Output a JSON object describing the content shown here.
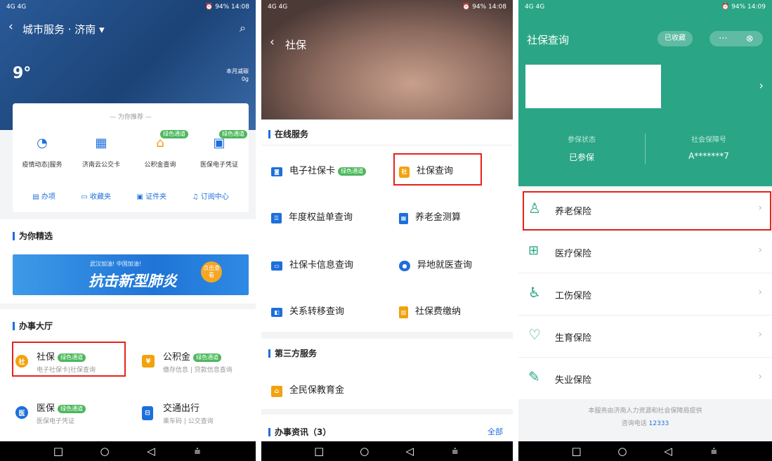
{
  "status": {
    "left": "4G 4G",
    "p1": "⏰ 94% 14:08",
    "p2": "⏰ 94% 14:08",
    "p3": "⏰ 94% 14:09"
  },
  "nav": {
    "square": "□",
    "circle": "○",
    "back": "◁",
    "menu": "⩧"
  },
  "screen1": {
    "title": "城市服务 · 济南 ▾",
    "temp": "9°",
    "air_label": "本月减碳",
    "air_value": "0g",
    "recommend_header": "为你推荐",
    "recommend": [
      {
        "label": "疫情动态|服务",
        "badge": ""
      },
      {
        "label": "济南云公交卡",
        "badge": ""
      },
      {
        "label": "公积金查询",
        "badge": "绿色通道"
      },
      {
        "label": "医保电子凭证",
        "badge": "绿色通道"
      }
    ],
    "tools": [
      "办项",
      "收藏夹",
      "证件夹",
      "订阅中心"
    ],
    "featured_title": "为你精选",
    "banner": {
      "small": "武汉加油! 中国加油!",
      "big": "抗击新型肺炎",
      "btn": "点击查看"
    },
    "hall_title": "办事大厅",
    "hall": [
      {
        "title": "社保",
        "badge": "绿色通道",
        "sub": "电子社保卡|社保查询",
        "color": "#f2a20d",
        "glyph": "社"
      },
      {
        "title": "公积金",
        "badge": "绿色通道",
        "sub": "缴存信息 | 贷款信息查询",
        "color": "#f2a20d",
        "glyph": "¥"
      },
      {
        "title": "医保",
        "badge": "绿色通道",
        "sub": "医保电子凭证",
        "color": "#1d6fdb",
        "glyph": "医"
      },
      {
        "title": "交通出行",
        "badge": "",
        "sub": "乘车码 | 公交查询",
        "color": "#1d6fdb",
        "glyph": "⊟"
      }
    ]
  },
  "screen2": {
    "title": "社保",
    "online_title": "在线服务",
    "services": [
      {
        "label": "电子社保卡",
        "badge": "绿色通道",
        "color": "#1d6fdb"
      },
      {
        "label": "社保查询",
        "badge": "",
        "color": "#f2a20d"
      },
      {
        "label": "年度权益单查询",
        "badge": "",
        "color": "#1d6fdb"
      },
      {
        "label": "养老金测算",
        "badge": "",
        "color": "#1d6fdb"
      },
      {
        "label": "社保卡信息查询",
        "badge": "",
        "color": "#1d6fdb"
      },
      {
        "label": "异地就医查询",
        "badge": "",
        "color": "#1d6fdb"
      },
      {
        "label": "关系转移查询",
        "badge": "",
        "color": "#1d6fdb"
      },
      {
        "label": "社保费缴纳",
        "badge": "",
        "color": "#f2a20d"
      }
    ],
    "third_title": "第三方服务",
    "third_item": "全民保教育金",
    "news_title": "办事资讯（3）",
    "news_all": "全部"
  },
  "screen3": {
    "title": "社保查询",
    "collected": "已收藏",
    "more": "···",
    "close": "⊗",
    "status_label": "参保状态",
    "status_value": "已参保",
    "id_label": "社会保障号",
    "id_value": "A*******7",
    "items": [
      "养老保险",
      "医疗保险",
      "工伤保险",
      "生育保险",
      "失业保险"
    ],
    "footer": "本服务由济南人力资源和社会保障局提供",
    "phone_label": "咨询电话",
    "phone": "12333"
  }
}
